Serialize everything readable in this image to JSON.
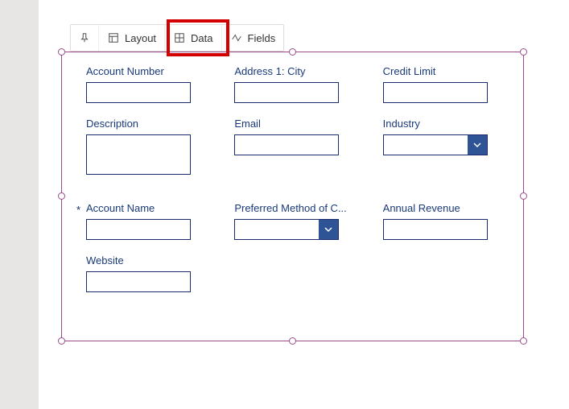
{
  "toolbar": {
    "layout_label": "Layout",
    "data_label": "Data",
    "fields_label": "Fields"
  },
  "form": {
    "section1": {
      "row1": {
        "f1": {
          "label": "Account Number"
        },
        "f2": {
          "label": "Address 1: City"
        },
        "f3": {
          "label": "Credit Limit"
        }
      },
      "row2": {
        "f1": {
          "label": "Description"
        },
        "f2": {
          "label": "Email"
        },
        "f3": {
          "label": "Industry"
        }
      }
    },
    "section2": {
      "row1": {
        "f1": {
          "label": "Account Name",
          "required_marker": "*"
        },
        "f2": {
          "label": "Preferred Method of C..."
        },
        "f3": {
          "label": "Annual Revenue"
        }
      },
      "row2": {
        "f1": {
          "label": "Website"
        }
      }
    }
  }
}
